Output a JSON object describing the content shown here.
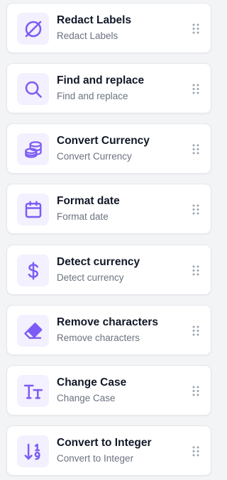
{
  "colors": {
    "accent": "#7c5cf5",
    "icon_bg": "#f3f0ff",
    "title": "#111827",
    "subtitle": "#6b7280",
    "grip": "#9ca3af"
  },
  "transforms": [
    {
      "icon": "slashed-circle-icon",
      "title": "Redact Labels",
      "subtitle": "Redact Labels"
    },
    {
      "icon": "magnifier-icon",
      "title": "Find and replace",
      "subtitle": "Find and replace"
    },
    {
      "icon": "coins-icon",
      "title": "Convert Currency",
      "subtitle": "Convert Currency"
    },
    {
      "icon": "calendar-icon",
      "title": "Format date",
      "subtitle": "Format date"
    },
    {
      "icon": "dollar-icon",
      "title": "Detect currency",
      "subtitle": "Detect currency"
    },
    {
      "icon": "eraser-icon",
      "title": "Remove characters",
      "subtitle": "Remove characters"
    },
    {
      "icon": "text-case-icon",
      "title": "Change Case",
      "subtitle": "Change Case"
    },
    {
      "icon": "sort-numeric-icon",
      "title": "Convert to Integer",
      "subtitle": "Convert to Integer"
    }
  ]
}
